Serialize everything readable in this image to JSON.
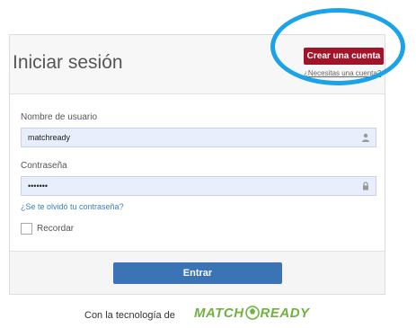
{
  "header": {
    "title": "Iniciar sesión",
    "create_account_label": "Crear una cuenta",
    "need_account_text": "¿Necesitas una cuenta?"
  },
  "form": {
    "username_label": "Nombre de usuario",
    "username_value": "matchready",
    "password_label": "Contraseña",
    "password_value": "•••••••",
    "forgot_password_label": "¿Se te olvidó tu contraseña?",
    "remember_label": "Recordar",
    "remember_checked": false,
    "submit_label": "Entrar"
  },
  "footer": {
    "powered_by_text": "Con la tecnología de",
    "brand_part1": "MATCH",
    "brand_part2": "READY"
  },
  "icons": {
    "username_icon": "user-icon",
    "password_icon": "lock-icon",
    "brand_icon": "ball-logo-icon"
  },
  "colors": {
    "create_account_bg": "#a3142b",
    "submit_bg": "#3b73b5",
    "link": "#3a7fbf",
    "highlight_ring": "#1aa3e8",
    "brand_green": "#6fb23f",
    "field_bg": "#e8eefb"
  }
}
